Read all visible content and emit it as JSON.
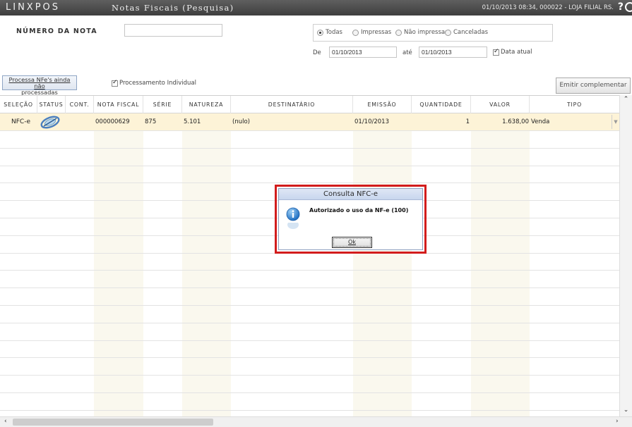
{
  "app": {
    "logo": "LINXPOS",
    "screen_title": "Notas Fiscais (Pesquisa)",
    "session_info": "01/10/2013 08:34, 000022 - LOJA FILIAL RS.",
    "help_icon": "help-icon",
    "clock_icon": "clock-icon"
  },
  "filters": {
    "numero_label": "NÚMERO DA NOTA",
    "numero_value": "",
    "status_options": [
      {
        "label": "Todas",
        "selected": true
      },
      {
        "label": "Impressas",
        "selected": false
      },
      {
        "label": "Não impressas",
        "selected": false
      },
      {
        "label": "Canceladas",
        "selected": false
      }
    ],
    "de_label": "De",
    "de_value": "01/10/2013",
    "ate_label": "até",
    "ate_value": "01/10/2013",
    "data_atual_label": "Data atual",
    "data_atual_checked": true
  },
  "actions": {
    "processa_line1": "Processa NFe's ainda não",
    "processa_line2": "processadas",
    "processamento_individual_label": "Processamento Individual",
    "processamento_individual_checked": true,
    "emitir_label": "Emitir complementar"
  },
  "grid": {
    "columns": [
      "SELEÇÃO",
      "STATUS",
      "CONT.",
      "NOTA FISCAL",
      "SÉRIE",
      "NATUREZA",
      "DESTINATÁRIO",
      "EMISSÃO",
      "QUANTIDADE",
      "VALOR",
      "TIPO"
    ],
    "rows": [
      {
        "selecao": "NFC-e",
        "status_icon": "nfe-status-icon",
        "cont": "",
        "nota_fiscal": "000000629",
        "serie": "875",
        "natureza": "5.101",
        "destinatario": "(nulo)",
        "emissao": "01/10/2013",
        "quantidade": "1",
        "valor": "1.638,00",
        "tipo": "Venda"
      }
    ]
  },
  "dialog": {
    "title": "Consulta NFC-e",
    "icon": "info-icon",
    "message": "Autorizado o uso da NF-e (100)",
    "ok_label": "Ok"
  },
  "colors": {
    "titlebar": "#4a4a4a",
    "row_highlight": "#fdf3d7",
    "column_shade": "#fbf9ef",
    "dialog_highlight_border": "#d21c1c"
  }
}
